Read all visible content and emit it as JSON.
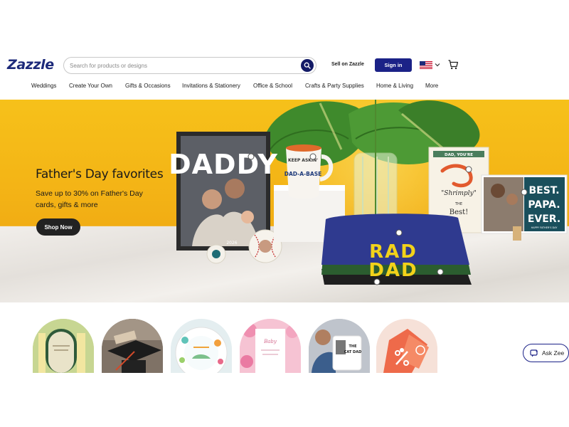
{
  "header": {
    "logo": "Zazzle",
    "search": {
      "placeholder": "Search for products or designs",
      "value": "",
      "button_icon": "search-icon"
    },
    "sell_label": "Sell on Zazzle",
    "signin_label": "Sign in",
    "locale_flag": "us-flag-icon",
    "cart_icon": "cart-icon"
  },
  "nav": {
    "items": [
      {
        "label": "Weddings"
      },
      {
        "label": "Create Your Own"
      },
      {
        "label": "Gifts & Occasions"
      },
      {
        "label": "Invitations & Stationery"
      },
      {
        "label": "Office & School"
      },
      {
        "label": "Crafts & Party Supplies"
      },
      {
        "label": "Home & Living"
      },
      {
        "label": "More"
      }
    ]
  },
  "hero": {
    "title": "Father's Day favorites",
    "subtitle": "Save up to 30% on Father's Day cards, gifts & more",
    "cta_label": "Shop Now",
    "products": {
      "frame_text": "DADDY",
      "frame_year": "2026",
      "mug_text": "DAD-A-BASE",
      "mug_top_text": "KEEP ASKIN'",
      "card_header": "DAD, YOU'RE",
      "card_script": "\"Shrimply\"",
      "card_the": "THE",
      "card_best": "Best!",
      "photo_card_text_1": "BEST.",
      "photo_card_text_2": "PAPA.",
      "photo_card_text_3": "EVER.",
      "photo_card_small": "HAPPY FATHER'S DAY",
      "shirt_text_1": "RAD",
      "shirt_text_2": "DAD"
    },
    "colors": {
      "background": "#f4b516",
      "cta": "#222222",
      "shirt": "#2f3a8f",
      "shirt_print": "#f2d21a"
    }
  },
  "categories": [
    {
      "name": "wedding-invitations"
    },
    {
      "name": "graduation-caps"
    },
    {
      "name": "birthday-plates"
    },
    {
      "name": "baby-shower-invitations"
    },
    {
      "name": "photo-mugs"
    },
    {
      "name": "sale-tags"
    }
  ],
  "ask_zee": {
    "label": "Ask Zee",
    "icon": "chat-icon"
  },
  "theme": {
    "brand_navy": "#1b2287",
    "logo_navy": "#1d2a7a"
  }
}
